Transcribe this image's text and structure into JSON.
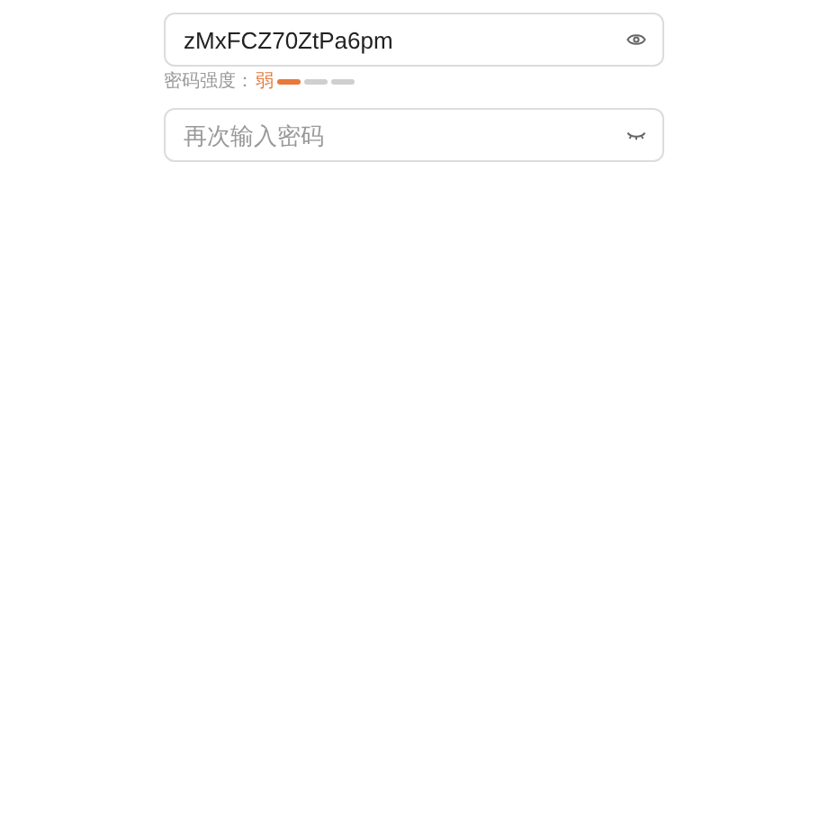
{
  "password_field": {
    "value": "zMxFCZ70ZtPa6pm",
    "visible": true
  },
  "strength": {
    "label": "密码强度：",
    "rating": "弱",
    "segments": [
      {
        "on": true
      },
      {
        "on": false
      },
      {
        "on": false
      }
    ]
  },
  "confirm_field": {
    "placeholder": "再次输入密码",
    "visible": false
  }
}
